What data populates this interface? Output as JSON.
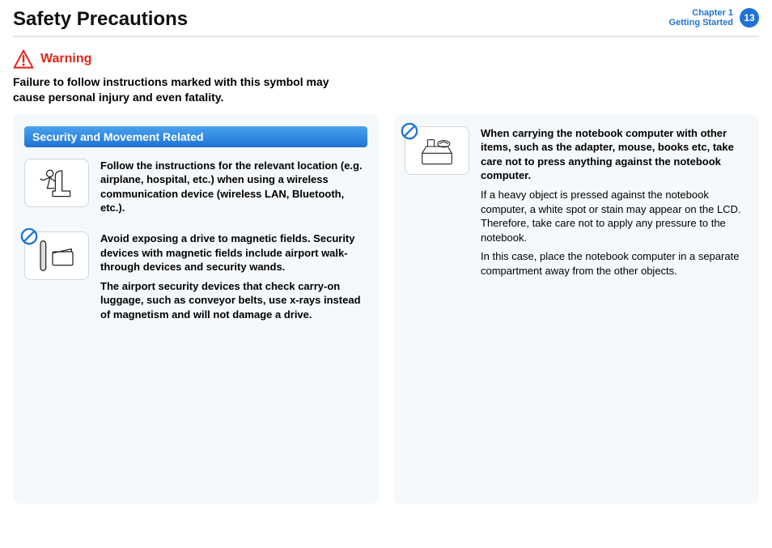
{
  "header": {
    "title": "Safety Precautions",
    "chapter_line1": "Chapter 1",
    "chapter_line2": "Getting Started",
    "page_number": "13"
  },
  "warning": {
    "label": "Warning",
    "text": "Failure to follow instructions marked with this symbol may cause personal injury and even fatality."
  },
  "section": {
    "banner": "Security and Movement Related"
  },
  "left": {
    "item1": {
      "bold": "Follow the instructions for the relevant location (e.g. airplane, hospital, etc.) when using a wireless communication device (wireless LAN, Bluetooth, etc.)."
    },
    "item2": {
      "bold1": "Avoid exposing a drive to magnetic fields. Security devices with magnetic fields include airport walk-through devices and security wands.",
      "bold2": "The airport security devices that check carry-on luggage, such as conveyor belts, use x-rays instead of magnetism and will not damage a drive."
    }
  },
  "right": {
    "item1": {
      "bold": "When carrying the notebook computer with other items, such as the adapter, mouse, books etc, take care not to press anything against the notebook computer.",
      "reg1": "If a heavy object is pressed against the notebook computer, a white spot or stain may appear on the LCD. Therefore, take care not to apply any pressure to the notebook.",
      "reg2": "In this case, place the notebook computer in a separate compartment away from the other objects."
    }
  }
}
